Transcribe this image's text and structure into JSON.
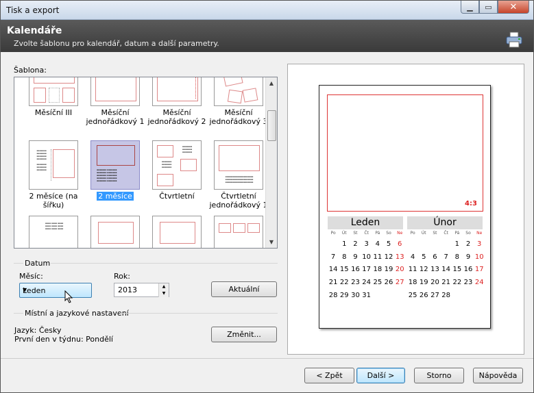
{
  "window": {
    "title": "Tisk a export"
  },
  "header": {
    "title": "Kalendáře",
    "subtitle": "Zvolte šablonu pro kalendář, datum a další parametry."
  },
  "templates": {
    "label": "Šablona:",
    "items": [
      {
        "label": "Měsíční III"
      },
      {
        "label": "Měsíční jednořádkový 1"
      },
      {
        "label": "Měsíční jednořádkový 2"
      },
      {
        "label": "Měsíční jednořádkový 3"
      },
      {
        "label": "2 měsíce (na šířku)"
      },
      {
        "label": "2 měsíce",
        "selected": true
      },
      {
        "label": "Čtvrtletní"
      },
      {
        "label": "Čtvrtletní jednořádkový 1"
      }
    ]
  },
  "date": {
    "group": "Datum",
    "month_label": "Měsíc:",
    "month_value": "Leden",
    "year_label": "Rok:",
    "year_value": "2013",
    "current_button": "Aktuální"
  },
  "locale": {
    "group": "Místní a jazykové nastavení",
    "language": "Jazyk: Česky",
    "first_day": "První den v týdnu: Pondělí",
    "change_button": "Změnit..."
  },
  "preview": {
    "ratio": "4:3",
    "months": [
      {
        "name": "Leden",
        "dow": [
          "Po",
          "Út",
          "St",
          "Čt",
          "Pá",
          "So",
          "Ne"
        ],
        "weeks": [
          [
            "",
            "1",
            "2",
            "3",
            "4",
            "5",
            "6"
          ],
          [
            "7",
            "8",
            "9",
            "10",
            "11",
            "12",
            "13"
          ],
          [
            "14",
            "15",
            "16",
            "17",
            "18",
            "19",
            "20"
          ],
          [
            "21",
            "22",
            "23",
            "24",
            "25",
            "26",
            "27"
          ],
          [
            "28",
            "29",
            "30",
            "31",
            "",
            "",
            ""
          ]
        ]
      },
      {
        "name": "Únor",
        "dow": [
          "Po",
          "Út",
          "St",
          "Čt",
          "Pá",
          "So",
          "Ne"
        ],
        "weeks": [
          [
            "",
            "",
            "",
            "",
            "1",
            "2",
            "3"
          ],
          [
            "4",
            "5",
            "6",
            "7",
            "8",
            "9",
            "10"
          ],
          [
            "11",
            "12",
            "13",
            "14",
            "15",
            "16",
            "17"
          ],
          [
            "18",
            "19",
            "20",
            "21",
            "22",
            "23",
            "24"
          ],
          [
            "25",
            "26",
            "27",
            "28",
            "",
            "",
            ""
          ]
        ]
      }
    ],
    "colors": {
      "weekend": "#dd2222",
      "frame": "#dd3333"
    }
  },
  "footer": {
    "back": "< Zpět",
    "next": "Další >",
    "cancel": "Storno",
    "help": "Nápověda"
  }
}
